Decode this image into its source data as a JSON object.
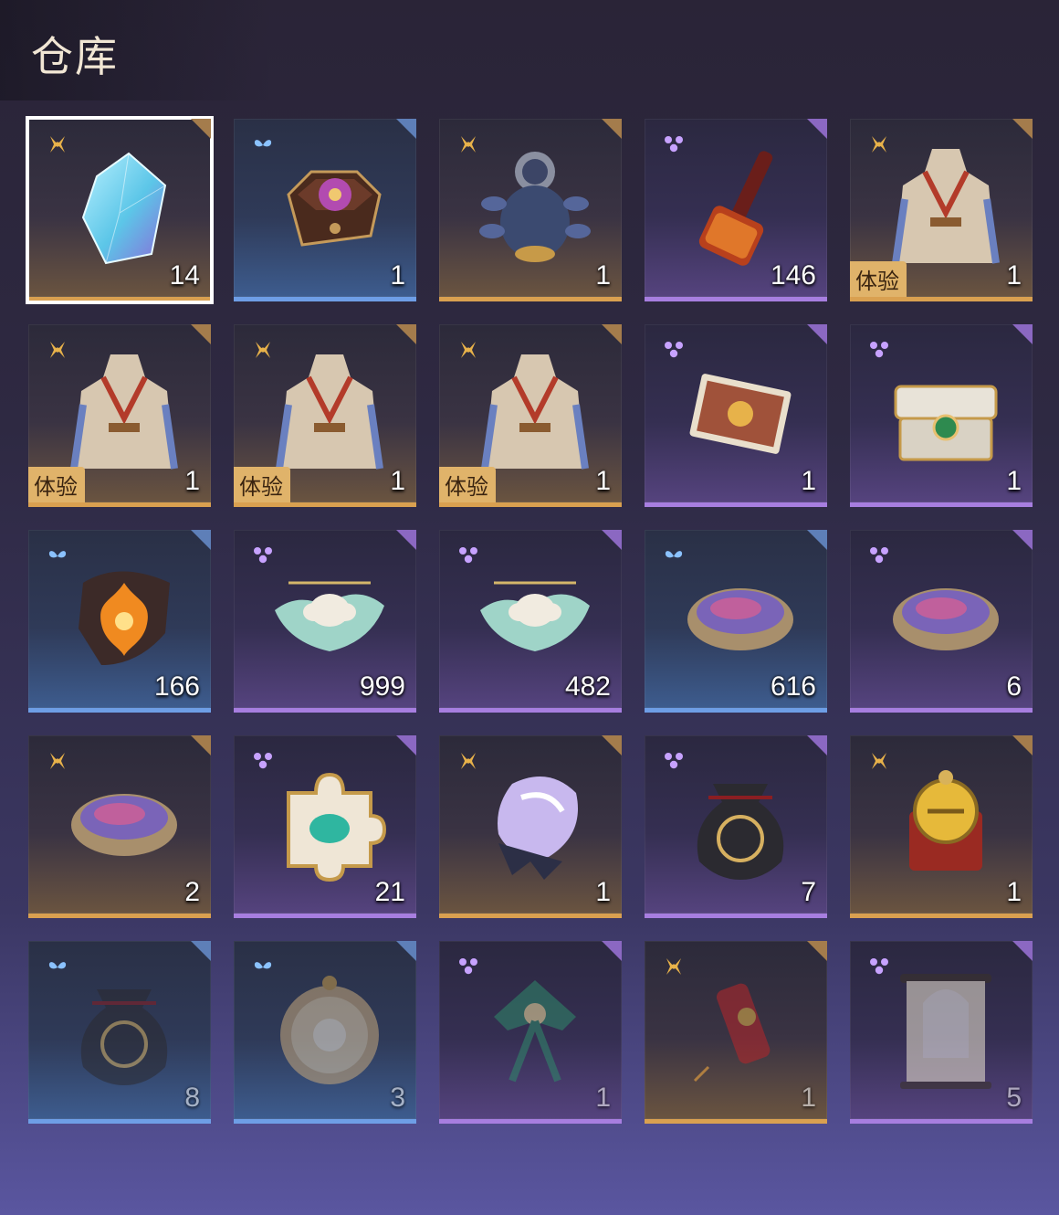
{
  "page": {
    "title": "仓库"
  },
  "items": [
    {
      "name": "crystal-shard",
      "rarity": "gold",
      "count": "14",
      "trial": "",
      "selected": true,
      "icon": "crystal-shard-icon"
    },
    {
      "name": "floral-box",
      "rarity": "blue",
      "count": "1",
      "trial": "",
      "icon": "floral-box-icon"
    },
    {
      "name": "lion-beast-figure",
      "rarity": "gold",
      "count": "1",
      "trial": "",
      "icon": "lion-figure-icon"
    },
    {
      "name": "fire-hammer",
      "rarity": "purple",
      "count": "146",
      "trial": "",
      "icon": "hammer-icon"
    },
    {
      "name": "red-dress-outfit",
      "rarity": "gold",
      "count": "1",
      "trial": "体验",
      "icon": "outfit-icon"
    },
    {
      "name": "white-blue-outfit",
      "rarity": "gold",
      "count": "1",
      "trial": "体验",
      "icon": "outfit-icon"
    },
    {
      "name": "blue-robe-outfit",
      "rarity": "gold",
      "count": "1",
      "trial": "体验",
      "icon": "outfit-icon"
    },
    {
      "name": "white-robe-outfit",
      "rarity": "gold",
      "count": "1",
      "trial": "体验",
      "icon": "outfit-icon"
    },
    {
      "name": "picture-card",
      "rarity": "purple",
      "count": "1",
      "trial": "",
      "icon": "card-icon"
    },
    {
      "name": "jade-chest",
      "rarity": "purple",
      "count": "1",
      "trial": "",
      "icon": "chest-icon"
    },
    {
      "name": "flame-emblem",
      "rarity": "blue",
      "count": "166",
      "trial": "",
      "icon": "flame-emblem-icon"
    },
    {
      "name": "lotus-pin-a",
      "rarity": "purple",
      "count": "999",
      "trial": "",
      "icon": "lotus-icon"
    },
    {
      "name": "lotus-pin-b",
      "rarity": "purple",
      "count": "482",
      "trial": "",
      "icon": "lotus-icon"
    },
    {
      "name": "powder-bowl",
      "rarity": "blue",
      "count": "616",
      "trial": "",
      "icon": "bowl-icon"
    },
    {
      "name": "tri-color-bowl",
      "rarity": "purple",
      "count": "6",
      "trial": "",
      "icon": "bowl-icon"
    },
    {
      "name": "rainbow-bowl",
      "rarity": "gold",
      "count": "2",
      "trial": "",
      "icon": "bowl-icon"
    },
    {
      "name": "jade-puzzle-piece",
      "rarity": "purple",
      "count": "21",
      "trial": "",
      "icon": "puzzle-piece-icon"
    },
    {
      "name": "pearl-shell",
      "rarity": "gold",
      "count": "1",
      "trial": "",
      "icon": "shell-icon"
    },
    {
      "name": "black-pouch",
      "rarity": "purple",
      "count": "7",
      "trial": "",
      "icon": "pouch-icon"
    },
    {
      "name": "gold-amulet",
      "rarity": "gold",
      "count": "1",
      "trial": "",
      "icon": "amulet-icon"
    },
    {
      "name": "embroidered-pouch",
      "rarity": "blue",
      "count": "8",
      "trial": "",
      "dim": true,
      "icon": "pouch-icon"
    },
    {
      "name": "round-drum",
      "rarity": "blue",
      "count": "3",
      "trial": "",
      "dim": true,
      "icon": "drum-icon"
    },
    {
      "name": "swallow-kite",
      "rarity": "purple",
      "count": "1",
      "trial": "",
      "dim": true,
      "icon": "kite-icon"
    },
    {
      "name": "firecracker",
      "rarity": "gold",
      "count": "1",
      "trial": "",
      "dim": true,
      "icon": "firecracker-icon"
    },
    {
      "name": "portrait-scroll",
      "rarity": "purple",
      "count": "5",
      "trial": "",
      "dim": true,
      "icon": "scroll-icon"
    }
  ],
  "colors": {
    "gold": "#d9a050",
    "blue": "#6e9ee6",
    "purple": "#a77ee0"
  }
}
